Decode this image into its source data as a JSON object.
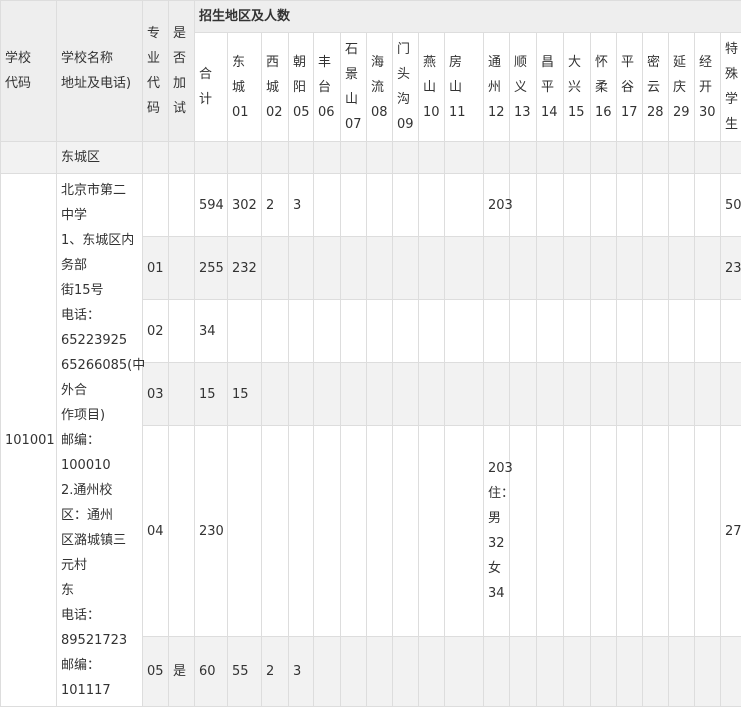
{
  "header": {
    "school_code": "学校\n代码",
    "school_name": "学校名称\n地址及电话)",
    "major_code": "专\n业\n代\n码",
    "extra_test": "是\n否\n加\n试",
    "region_title": "招生地区及人数",
    "regions": [
      "合\n计",
      "东\n城\n01",
      "西\n城\n02",
      "朝\n阳\n05",
      "丰\n台\n06",
      "石\n景\n山\n07",
      "海\n流\n08",
      "门\n头\n沟\n09",
      "燕\n山\n10",
      "房\n山\n11",
      "通州\n12",
      "顺\n义\n13",
      "昌\n平\n14",
      "大\n兴\n15",
      "怀\n柔\n16",
      "平\n谷\n17",
      "密\n云\n28",
      "延\n庆\n29",
      "经\n开\n30",
      "特\n殊\n学\n生"
    ]
  },
  "district": "东城区",
  "school": {
    "code": "101001",
    "info": "北京市第二\n中学\n1、东城区内\n务部\n街15号\n电话：\n65223925\n65266085(中\n外合\n作项目)\n邮编：\n100010\n2.通州校\n区：通州\n区潞城镇三\n元村\n东\n电话：\n89521723\n邮编：\n101117"
  },
  "rows": [
    {
      "major": "",
      "extra": "",
      "cells": [
        "594",
        "302",
        "2",
        "3",
        "",
        "",
        "",
        "",
        "",
        "",
        "203",
        "",
        "",
        "",
        "",
        "",
        "",
        "",
        "",
        "50"
      ]
    },
    {
      "major": "01",
      "extra": "",
      "cells": [
        "255",
        "232",
        "",
        "",
        "",
        "",
        "",
        "",
        "",
        "",
        "",
        "",
        "",
        "",
        "",
        "",
        "",
        "",
        "",
        "23"
      ]
    },
    {
      "major": "02",
      "extra": "",
      "cells": [
        "34",
        "",
        "",
        "",
        "",
        "",
        "",
        "",
        "",
        "",
        "",
        "",
        "",
        "",
        "",
        "",
        "",
        "",
        "",
        ""
      ]
    },
    {
      "major": "03",
      "extra": "",
      "cells": [
        "15",
        "15",
        "",
        "",
        "",
        "",
        "",
        "",
        "",
        "",
        "",
        "",
        "",
        "",
        "",
        "",
        "",
        "",
        "",
        ""
      ]
    },
    {
      "major": "04",
      "extra": "",
      "cells": [
        "230",
        "",
        "",
        "",
        "",
        "",
        "",
        "",
        "",
        "",
        "203\n住：\n男32\n女34",
        "",
        "",
        "",
        "",
        "",
        "",
        "",
        "",
        "27"
      ]
    },
    {
      "major": "05",
      "extra": "是",
      "cells": [
        "60",
        "55",
        "2",
        "3",
        "",
        "",
        "",
        "",
        "",
        "",
        "",
        "",
        "",
        "",
        "",
        "",
        "",
        "",
        "",
        ""
      ]
    }
  ]
}
